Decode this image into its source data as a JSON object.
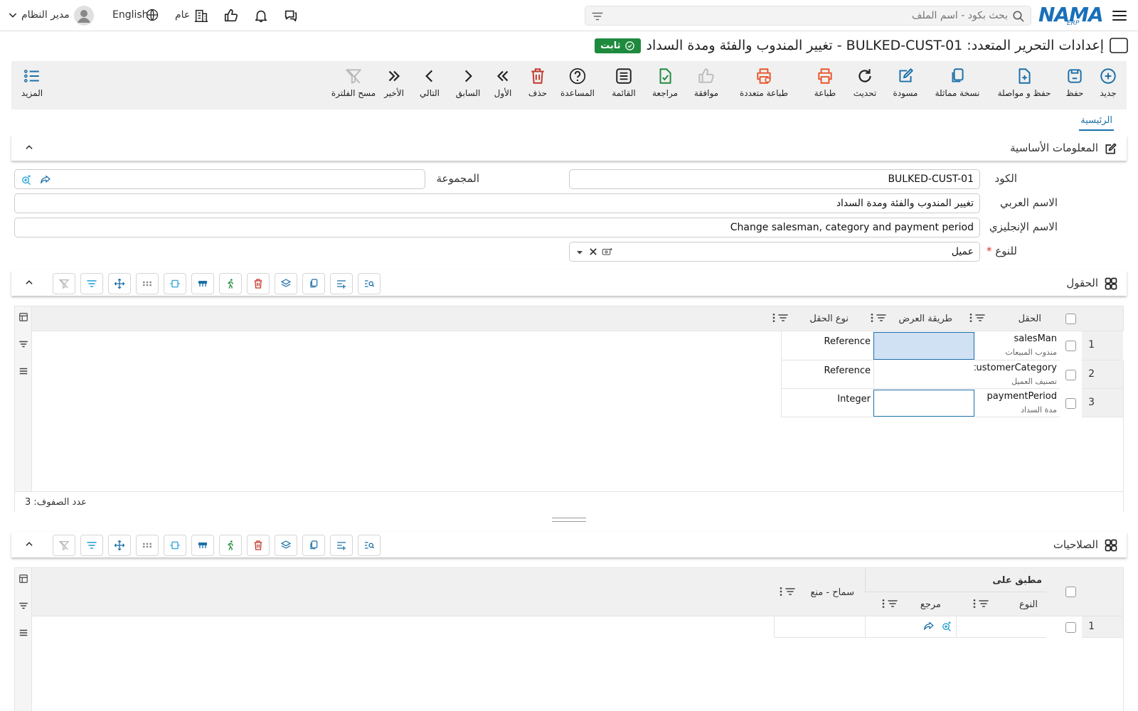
{
  "header": {
    "brand": "NAMA",
    "brand_sub": "ERP",
    "search_placeholder": "بحث بكود - اسم الملف",
    "user_name": "مدير النظام",
    "language": "English",
    "branch": "عام"
  },
  "page": {
    "title": "إعدادات التحرير المتعدد: BULKED-CUST-01 - تغيير المندوب والفئة ومدة السداد",
    "status_badge": "ثابت"
  },
  "toolbar": {
    "new": "جديد",
    "save": "حفظ",
    "save_continue": "حفظ و مواصلة",
    "duplicate": "نسخة مماثلة",
    "draft": "مسودة",
    "refresh": "تحديث",
    "print": "طباعة",
    "multi_print": "طباعة متعددة",
    "approve": "موافقة",
    "review": "مراجعة",
    "list": "القائمة",
    "help": "المساعدة",
    "delete": "حذف",
    "first": "الأول",
    "previous": "السابق",
    "next": "التالي",
    "last": "الأخير",
    "clear_filter": "مسح الفلترة",
    "more": "المزيد"
  },
  "tabs": {
    "main": "الرئيسية"
  },
  "basic_info": {
    "title": "المعلومات الأساسية",
    "code_label": "الكود",
    "code_value": "BULKED-CUST-01",
    "group_label": "المجموعة",
    "group_value": "",
    "arabic_name_label": "الاسم العربي",
    "arabic_name_value": "تغيير المندوب والفئة ومدة السداد",
    "english_name_label": "الاسم الإنجليزي",
    "english_name_value": "Change salesman, category and payment period",
    "type_label": "للنوع",
    "type_value": "عميل"
  },
  "fields_section": {
    "title": "الحقول",
    "columns": {
      "field": "الحقل",
      "display_method": "طريقة العرض",
      "field_type": "نوع الحقل"
    },
    "rows": [
      {
        "num": "1",
        "field": "salesMan",
        "field_ar": "مندوب المبيعات",
        "field_type": "Reference"
      },
      {
        "num": "2",
        "field": "customerCategory",
        "field_ar": "تصنيف العميل",
        "field_type": "Reference"
      },
      {
        "num": "3",
        "field": "paymentPeriod",
        "field_ar": "مدة السداد",
        "field_type": "Integer"
      }
    ],
    "row_count": "عدد الصفوف: 3"
  },
  "permissions_section": {
    "title": "الصلاحيات",
    "columns": {
      "applied_on": "مطبق على",
      "type": "النوع",
      "reference": "مرجع",
      "allow_deny": "سماح - منع"
    },
    "rows": [
      {
        "num": "1"
      }
    ]
  },
  "colors": {
    "primary": "#1b6fa8",
    "success": "#1e8a3d",
    "danger": "#c0392b",
    "orange": "#e8552b"
  }
}
